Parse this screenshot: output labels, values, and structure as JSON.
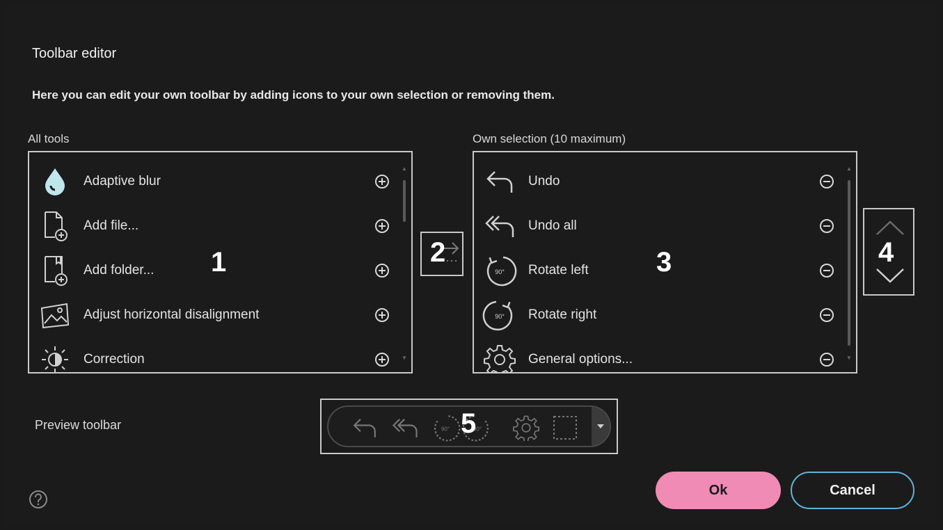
{
  "dialog": {
    "title": "Toolbar editor",
    "description": "Here you can edit your own toolbar by adding icons to your own selection or removing them."
  },
  "all_tools": {
    "label": "All tools",
    "items": [
      {
        "label": "Adaptive blur",
        "icon": "drop-icon"
      },
      {
        "label": "Add file...",
        "icon": "add-file-icon"
      },
      {
        "label": "Add folder...",
        "icon": "add-folder-icon"
      },
      {
        "label": "Adjust horizontal disalignment",
        "icon": "image-align-icon"
      },
      {
        "label": "Correction",
        "icon": "brightness-icon"
      }
    ],
    "action_icon": "plus-circle-icon"
  },
  "own_selection": {
    "label": "Own selection (10 maximum)",
    "items": [
      {
        "label": "Undo",
        "icon": "undo-icon"
      },
      {
        "label": "Undo all",
        "icon": "undo-all-icon"
      },
      {
        "label": "Rotate left",
        "icon": "rotate-left-icon"
      },
      {
        "label": "Rotate right",
        "icon": "rotate-right-icon"
      },
      {
        "label": "General options...",
        "icon": "gear-icon"
      }
    ],
    "action_icon": "minus-circle-icon"
  },
  "callouts": {
    "c1": "1",
    "c2": "2",
    "c3": "3",
    "c4": "4",
    "c5": "5"
  },
  "preview": {
    "label": "Preview toolbar",
    "icons": [
      "undo-icon",
      "undo-all-icon",
      "rotate-left-icon",
      "rotate-right-icon",
      "gear-icon",
      "selection-icon"
    ],
    "rotate_text": "90°"
  },
  "buttons": {
    "ok": "Ok",
    "cancel": "Cancel"
  },
  "colors": {
    "accent_pink": "#f08bb5",
    "accent_blue": "#5fb3d6",
    "drop_teal": "#bfe6ec"
  }
}
